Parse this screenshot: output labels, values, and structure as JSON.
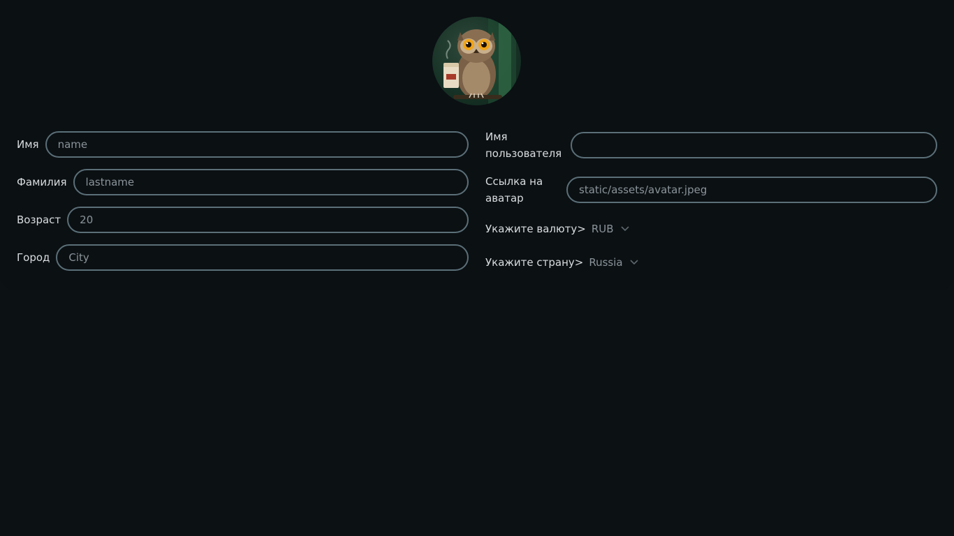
{
  "profile": {
    "avatar_icon": "owl-avatar"
  },
  "left": {
    "name": {
      "label": "Имя",
      "placeholder": "name",
      "value": ""
    },
    "lastname": {
      "label": "Фамилия",
      "placeholder": "lastname",
      "value": ""
    },
    "age": {
      "label": "Возраст",
      "placeholder": "",
      "value": "20"
    },
    "city": {
      "label": "Город",
      "placeholder": "City",
      "value": ""
    }
  },
  "right": {
    "username": {
      "label": "Имя пользователя",
      "placeholder": "",
      "value": ""
    },
    "avatar_link": {
      "label": "Ссылка на аватар",
      "placeholder": "",
      "value": "static/assets/avatar.jpeg"
    },
    "currency": {
      "label": "Укажите валюту>",
      "selected": "RUB"
    },
    "country": {
      "label": "Укажите страну>",
      "selected": "Russia"
    }
  },
  "colors": {
    "background": "#0c1114",
    "field_border": "#5b6f78",
    "text": "#d9dde0",
    "muted_text": "#8a949a"
  }
}
